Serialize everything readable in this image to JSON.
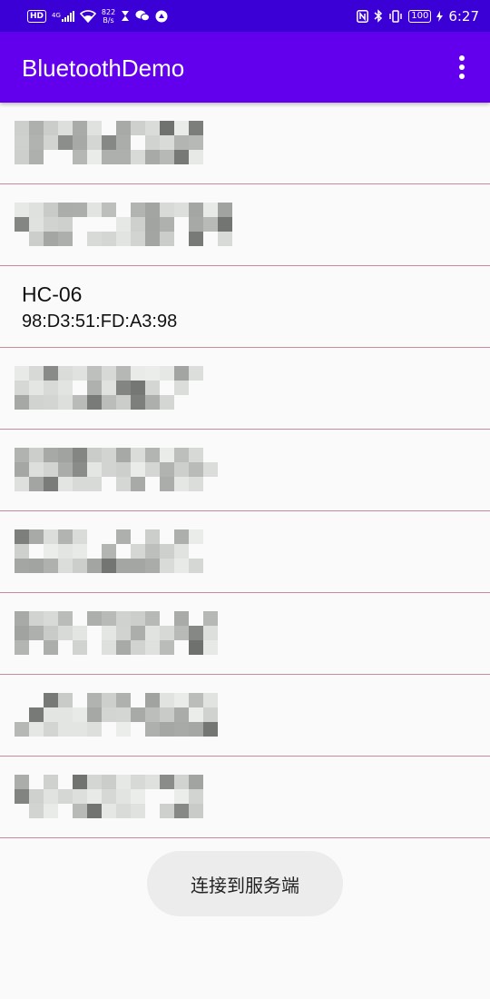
{
  "status_bar": {
    "left": {
      "hd": "HD",
      "network": "4G",
      "speed_value": "822",
      "speed_unit": "B/s"
    },
    "right": {
      "battery": "100",
      "time": "6:27"
    }
  },
  "app_bar": {
    "title": "BluetoothDemo"
  },
  "device_list": [
    {
      "name": "",
      "address": "",
      "obscured": true
    },
    {
      "name": "",
      "address": "",
      "obscured": true
    },
    {
      "name": "HC-06",
      "address": "98:D3:51:FD:A3:98",
      "obscured": false
    },
    {
      "name": "",
      "address": "",
      "obscured": true
    },
    {
      "name": "",
      "address": "",
      "obscured": true
    },
    {
      "name": "",
      "address": "",
      "obscured": true
    },
    {
      "name": "",
      "address": "",
      "obscured": true
    },
    {
      "name": "",
      "address": "",
      "obscured": true
    },
    {
      "name": "",
      "address": "",
      "obscured": true
    }
  ],
  "toast": {
    "message": "连接到服务端"
  },
  "colors": {
    "status_bar": "#3a00d6",
    "app_bar": "#6200ee",
    "divider": "#c98a9a",
    "background": "#fafafa"
  }
}
